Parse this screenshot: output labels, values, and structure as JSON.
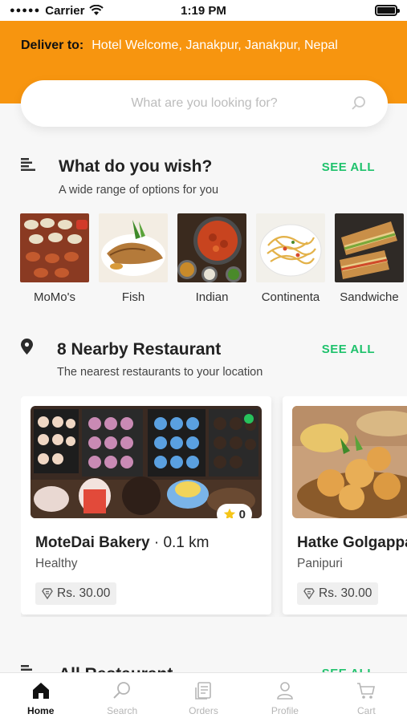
{
  "status_bar": {
    "carrier": "Carrier",
    "time": "1:19 PM"
  },
  "header": {
    "deliver_label": "Deliver to:",
    "address": "Hotel Welcome, Janakpur, Janakpur, Nepal"
  },
  "search": {
    "placeholder": "What are you looking for?"
  },
  "wish_section": {
    "title": "What do you wish?",
    "subtitle": "A wide range of options for you",
    "see_all": "SEE ALL"
  },
  "categories": [
    {
      "label": "MoMo's"
    },
    {
      "label": "Fish"
    },
    {
      "label": "Indian"
    },
    {
      "label": "Continenta"
    },
    {
      "label": "Sandwiche"
    }
  ],
  "nearby_section": {
    "title": "8 Nearby Restaurant",
    "subtitle": "The nearest restaurants to your location",
    "see_all": "SEE ALL"
  },
  "restaurants": [
    {
      "name": "MoteDai Bakery",
      "distance": "· 0.1 km",
      "tag": "Healthy",
      "price": "Rs. 30.00",
      "rating": "0"
    },
    {
      "name": "Hatke Golgappa",
      "distance": "",
      "tag": "Panipuri",
      "price": "Rs. 30.00",
      "rating": ""
    }
  ],
  "next_section": {
    "title": "All Restaurant",
    "see_all": "SEE ALL"
  },
  "bottom_nav": [
    {
      "label": "Home",
      "icon": "home-icon",
      "active": true
    },
    {
      "label": "Search",
      "icon": "search-icon",
      "active": false
    },
    {
      "label": "Orders",
      "icon": "orders-icon",
      "active": false
    },
    {
      "label": "Profile",
      "icon": "profile-icon",
      "active": false
    },
    {
      "label": "Cart",
      "icon": "cart-icon",
      "active": false
    }
  ],
  "colors": {
    "brand_orange": "#f7950f",
    "accent_green": "#1fc26c"
  }
}
